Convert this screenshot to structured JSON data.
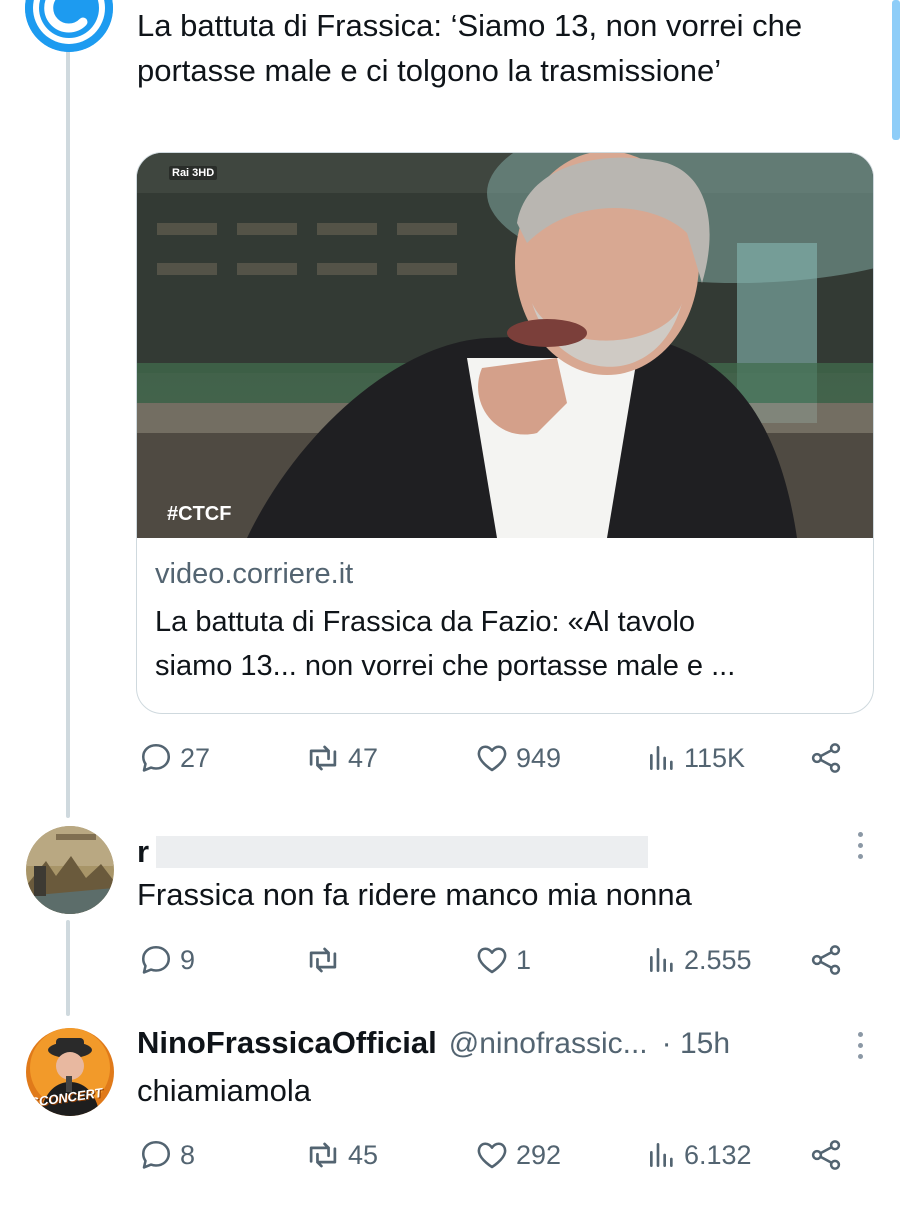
{
  "tweet1": {
    "text": "La battuta di Frassica: ‘Siamo 13, non vorrei che portasse male e ci tolgono la trasmissione’",
    "card": {
      "channel_logo": "Rai 3HD",
      "hashtag": "#CTCF",
      "domain": "video.corriere.it",
      "title_line1": "La battuta di Frassica da Fazio: «Al tavolo",
      "title_line2": "siamo 13... non vorrei che portasse male e ..."
    },
    "replies": "27",
    "reposts": "47",
    "likes": "949",
    "views": "115K"
  },
  "tweet2": {
    "name_visible": "r",
    "text": "Frassica non fa ridere manco mia nonna",
    "replies": "9",
    "reposts": "",
    "likes": "1",
    "views": "2.555"
  },
  "tweet3": {
    "display_name": "NinoFrassicaOfficial",
    "handle": "@ninofrassic...",
    "time": "· 15h",
    "text": "chiamiamola",
    "avatar_label": "SCONCERT",
    "replies": "8",
    "reposts": "45",
    "likes": "292",
    "views": "6.132"
  },
  "colors": {
    "text": "#0f1419",
    "muted": "#536471",
    "border": "#cfd9de",
    "thread_line": "#cfd9de",
    "brand_avatar": "#1d9bf0"
  },
  "icons": [
    "reply-icon",
    "repost-icon",
    "like-icon",
    "views-icon",
    "share-icon",
    "more-icon"
  ]
}
